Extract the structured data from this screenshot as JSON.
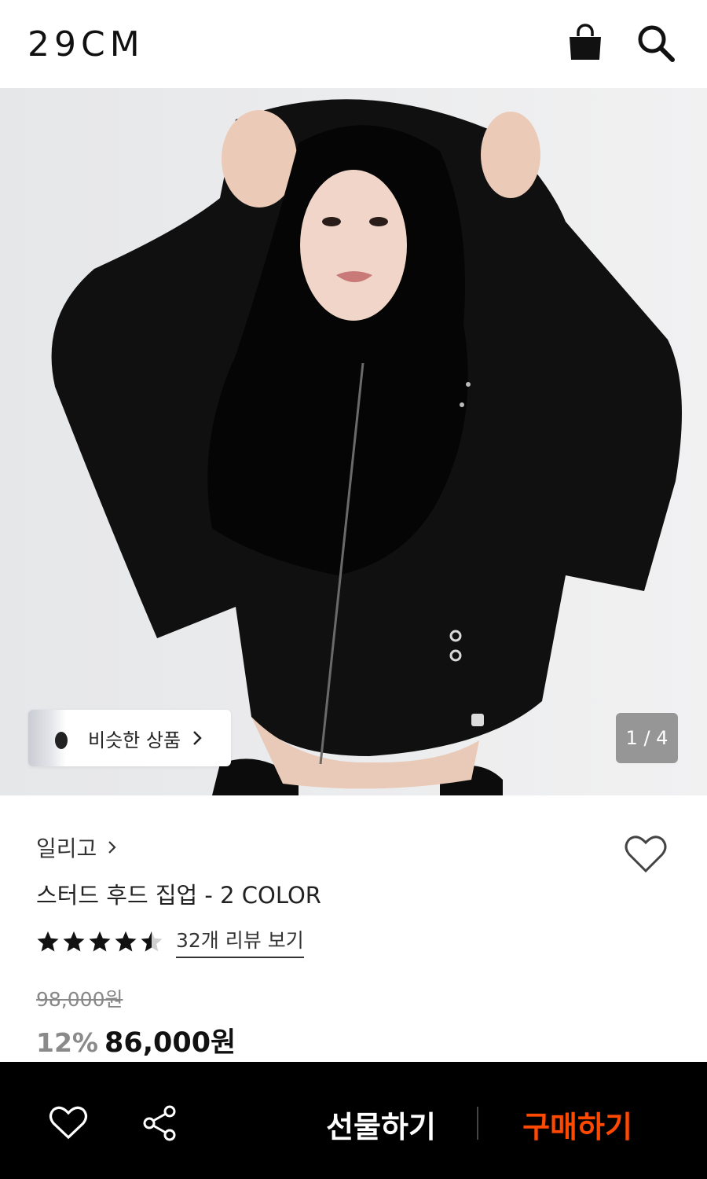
{
  "header": {
    "logo": "29CM",
    "bag_icon": "shopping-bag-icon",
    "search_icon": "search-icon"
  },
  "hero": {
    "image_alt": "product-photo",
    "similar_label": "비슷한 상품",
    "pager": "1 / 4"
  },
  "product": {
    "brand": "일리고",
    "title": "스터드 후드 집업 - 2 COLOR",
    "rating": 4.5,
    "review_link": "32개 리뷰 보기",
    "original_price": "98,000원",
    "discount": "12%",
    "price": "86,000원"
  },
  "bottom_bar": {
    "gift_label": "선물하기",
    "buy_label": "구매하기",
    "colors": {
      "background": "#000000",
      "buy": "#ff4800",
      "gift": "#ffffff"
    }
  }
}
